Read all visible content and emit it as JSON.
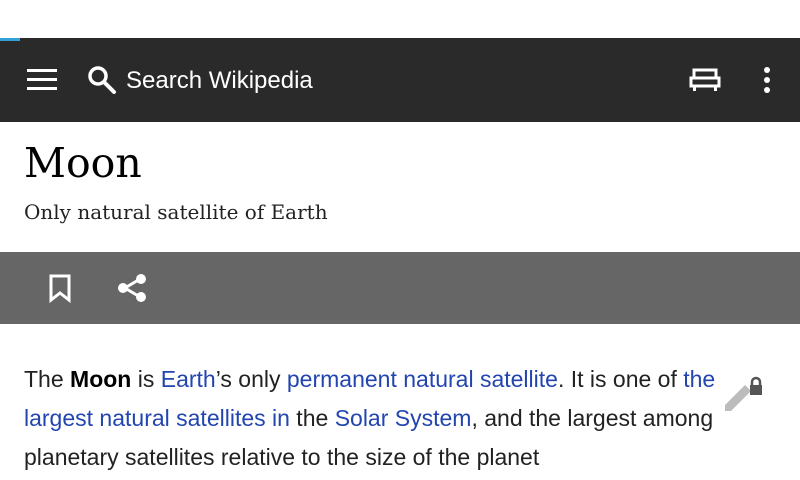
{
  "colors": {
    "toolbar_bg": "#2a2a2a",
    "actionbar_bg": "#666666",
    "link": "#2245b0",
    "progress": "#33a0d8"
  },
  "toolbar": {
    "menu_icon": "hamburger-menu-icon",
    "search_icon": "search-icon",
    "search_label": "Search Wikipedia",
    "reading_icon": "reading-list-icon",
    "overflow_icon": "more-vert-icon"
  },
  "article": {
    "title": "Moon",
    "subtitle": "Only natural satellite of Earth"
  },
  "actions": {
    "bookmark_icon": "bookmark-icon",
    "share_icon": "share-icon"
  },
  "content": {
    "p1": "The ",
    "p2_bold": "Moon",
    "p3": " is ",
    "link_earth": "Earth",
    "p4": "’s only ",
    "link_permanent": "permanent natural satellite",
    "p5": ". It is one of ",
    "link_largest": "the largest natural satellites in",
    "p6": " the ",
    "link_solar": "Solar System",
    "p7": ", and the largest among planetary satellites relative to the size of the planet",
    "edit_icon": "edit-locked-icon"
  }
}
